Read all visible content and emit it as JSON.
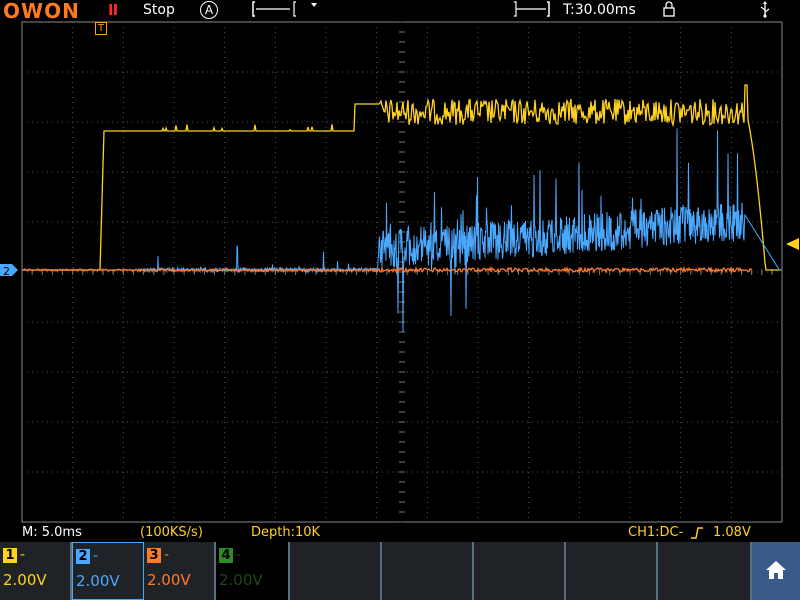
{
  "header": {
    "logo": "OWON",
    "run_state_icon": "pause-icon",
    "run_state": "Stop",
    "trigger_mode": "A",
    "time_offset": "T:30.00ms",
    "lock_icon": "lock-icon",
    "usb_icon": "usb-icon"
  },
  "trigger_marker": "T",
  "status": {
    "timebase": "M: 5.0ms",
    "sample_rate": "(100KS/s)",
    "depth": "Depth:10K",
    "trigger_info": "CH1:DC-",
    "trigger_level": "1.08V"
  },
  "channels": [
    {
      "num": "1",
      "coupling": "-",
      "scale": "2.00V",
      "color": "#ffd21e",
      "active": true
    },
    {
      "num": "2",
      "coupling": "-",
      "scale": "2.00V",
      "color": "#4aa8ff",
      "active": true
    },
    {
      "num": "3",
      "coupling": "-",
      "scale": "2.00V",
      "color": "#ff7a2a",
      "active": true
    },
    {
      "num": "4",
      "coupling": "-",
      "scale": "2.00V",
      "color": "#35a02a",
      "active": false
    }
  ],
  "ch2_marker": "2",
  "colors": {
    "ch1": "#ffd21e",
    "ch2": "#4aa8ff",
    "ch3": "#ff7a2a",
    "grid": "#555555",
    "menu_bg": "#5a6f80",
    "home_bg": "#3a5a8a"
  },
  "home_icon": "home-icon"
}
